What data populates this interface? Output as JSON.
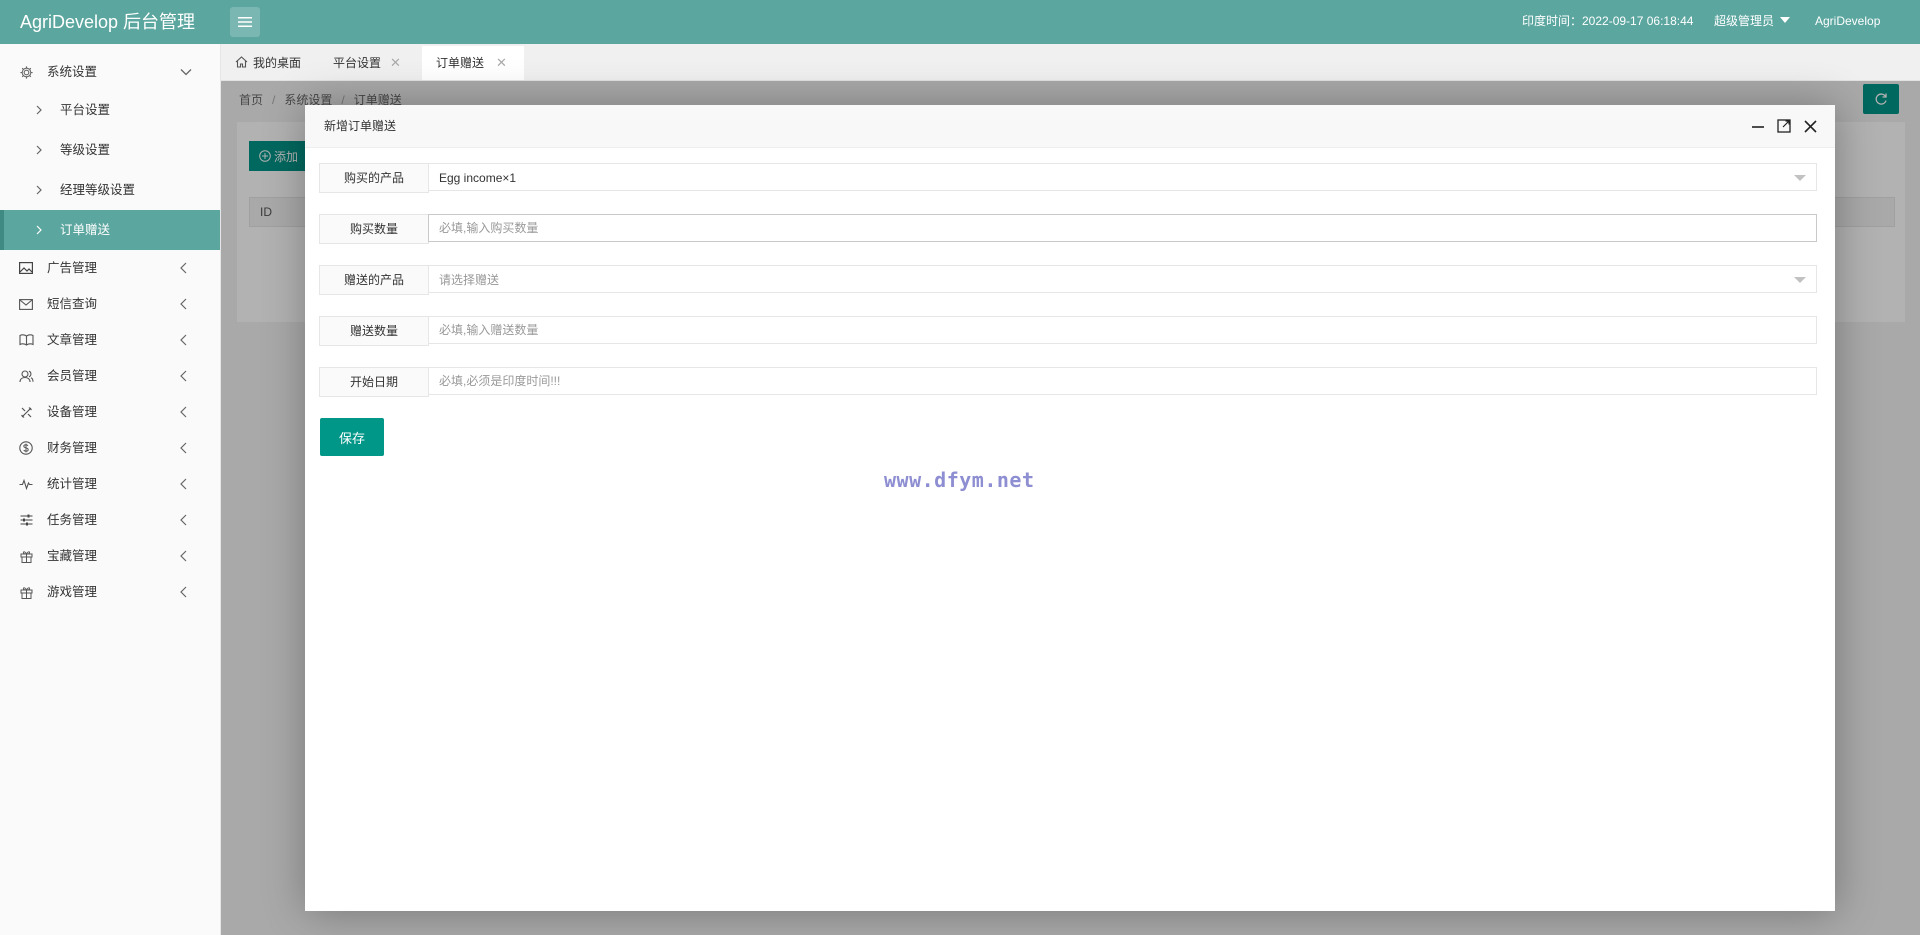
{
  "header": {
    "brand": "AgriDevelop 后台管理",
    "time_label": "印度时间：2022-09-17 06:18:44",
    "user_menu": "超级管理员",
    "app_name": "AgriDevelop",
    "bg_color": "#5ba69f"
  },
  "sidebar": {
    "group": {
      "label": "系统设置",
      "icon": "gear-icon"
    },
    "sub_items": [
      {
        "label": "平台设置"
      },
      {
        "label": "等级设置"
      },
      {
        "label": "经理等级设置"
      },
      {
        "label": "订单赠送",
        "active": true
      }
    ],
    "items": [
      {
        "label": "广告管理",
        "icon": "image-icon"
      },
      {
        "label": "短信查询",
        "icon": "mail-icon"
      },
      {
        "label": "文章管理",
        "icon": "book-icon"
      },
      {
        "label": "会员管理",
        "icon": "users-icon"
      },
      {
        "label": "设备管理",
        "icon": "tools-icon"
      },
      {
        "label": "财务管理",
        "icon": "dollar-icon"
      },
      {
        "label": "统计管理",
        "icon": "pulse-icon"
      },
      {
        "label": "任务管理",
        "icon": "sliders-icon"
      },
      {
        "label": "宝藏管理",
        "icon": "gift-icon"
      },
      {
        "label": "游戏管理",
        "icon": "gift-icon"
      }
    ]
  },
  "tabs": [
    {
      "label": "我的桌面",
      "icon": "home-icon"
    },
    {
      "label": "平台设置",
      "closable": true
    },
    {
      "label": "订单赠送",
      "closable": true,
      "active": true
    }
  ],
  "content": {
    "breadcrumb": [
      "首页",
      "系统设置",
      "订单赠送"
    ],
    "add_label": "添加",
    "table_headers": [
      "ID"
    ]
  },
  "modal": {
    "title": "新增订单赠送",
    "fields": {
      "buy_product": {
        "label": "购买的产品",
        "value": "Egg income×1"
      },
      "buy_qty": {
        "label": "购买数量",
        "placeholder": "必填,输入购买数量"
      },
      "gift_product": {
        "label": "赠送的产品",
        "placeholder": "请选择赠送"
      },
      "gift_qty": {
        "label": "赠送数量",
        "placeholder": "必填,输入赠送数量"
      },
      "start_date": {
        "label": "开始日期",
        "placeholder": "必填,必须是印度时间!!!"
      }
    },
    "save_label": "保存",
    "watermark": "www.dfym.net",
    "accent_color": "#009688"
  }
}
